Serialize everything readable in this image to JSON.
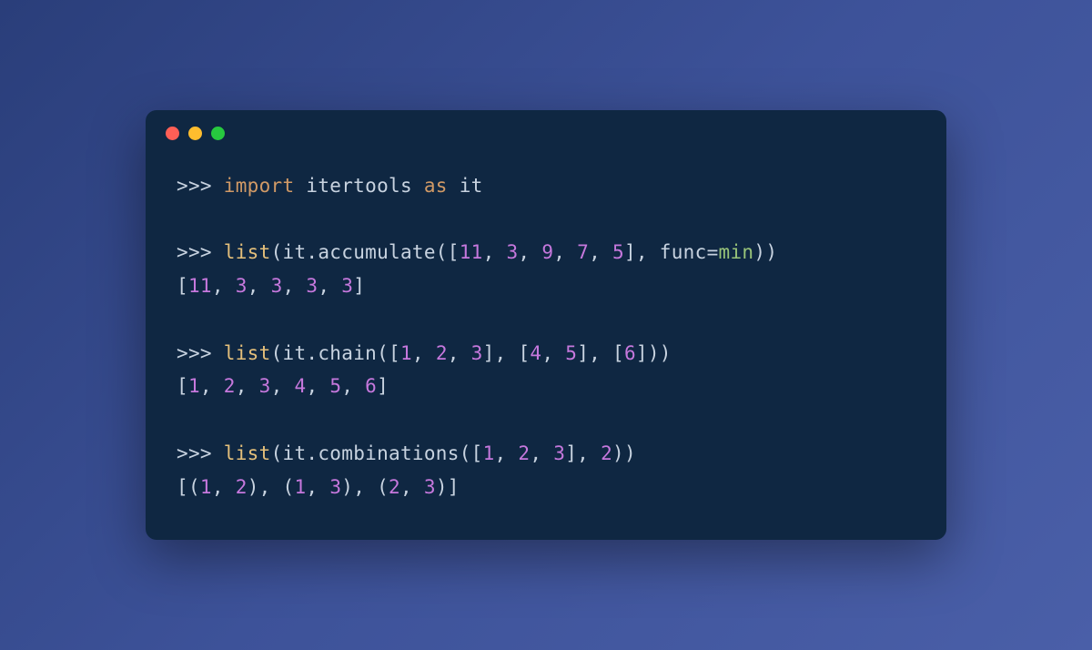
{
  "titlebar": {
    "red": "close",
    "yellow": "minimize",
    "green": "maximize"
  },
  "prompt": ">>> ",
  "lines": {
    "l1": {
      "kw_import": "import",
      "module": "itertools",
      "kw_as": "as",
      "alias": "it"
    },
    "l2": {
      "fn": "list",
      "obj": "it",
      "method": "accumulate",
      "args_open": "([",
      "nums": [
        "11",
        "3",
        "9",
        "7",
        "5"
      ],
      "args_close": "], ",
      "kwarg_name": "func",
      "kwarg_eq": "=",
      "kwarg_val": "min",
      "end": "))"
    },
    "l3": {
      "out_open": "[",
      "nums": [
        "11",
        "3",
        "3",
        "3",
        "3"
      ],
      "out_close": "]"
    },
    "l4": {
      "fn": "list",
      "obj": "it",
      "method": "chain",
      "lists": [
        [
          "1",
          "2",
          "3"
        ],
        [
          "4",
          "5"
        ],
        [
          "6"
        ]
      ]
    },
    "l5": {
      "out_open": "[",
      "nums": [
        "1",
        "2",
        "3",
        "4",
        "5",
        "6"
      ],
      "out_close": "]"
    },
    "l6": {
      "fn": "list",
      "obj": "it",
      "method": "combinations",
      "nums": [
        "1",
        "2",
        "3"
      ],
      "k": "2"
    },
    "l7": {
      "tuples": [
        [
          "1",
          "2"
        ],
        [
          "1",
          "3"
        ],
        [
          "2",
          "3"
        ]
      ]
    }
  }
}
